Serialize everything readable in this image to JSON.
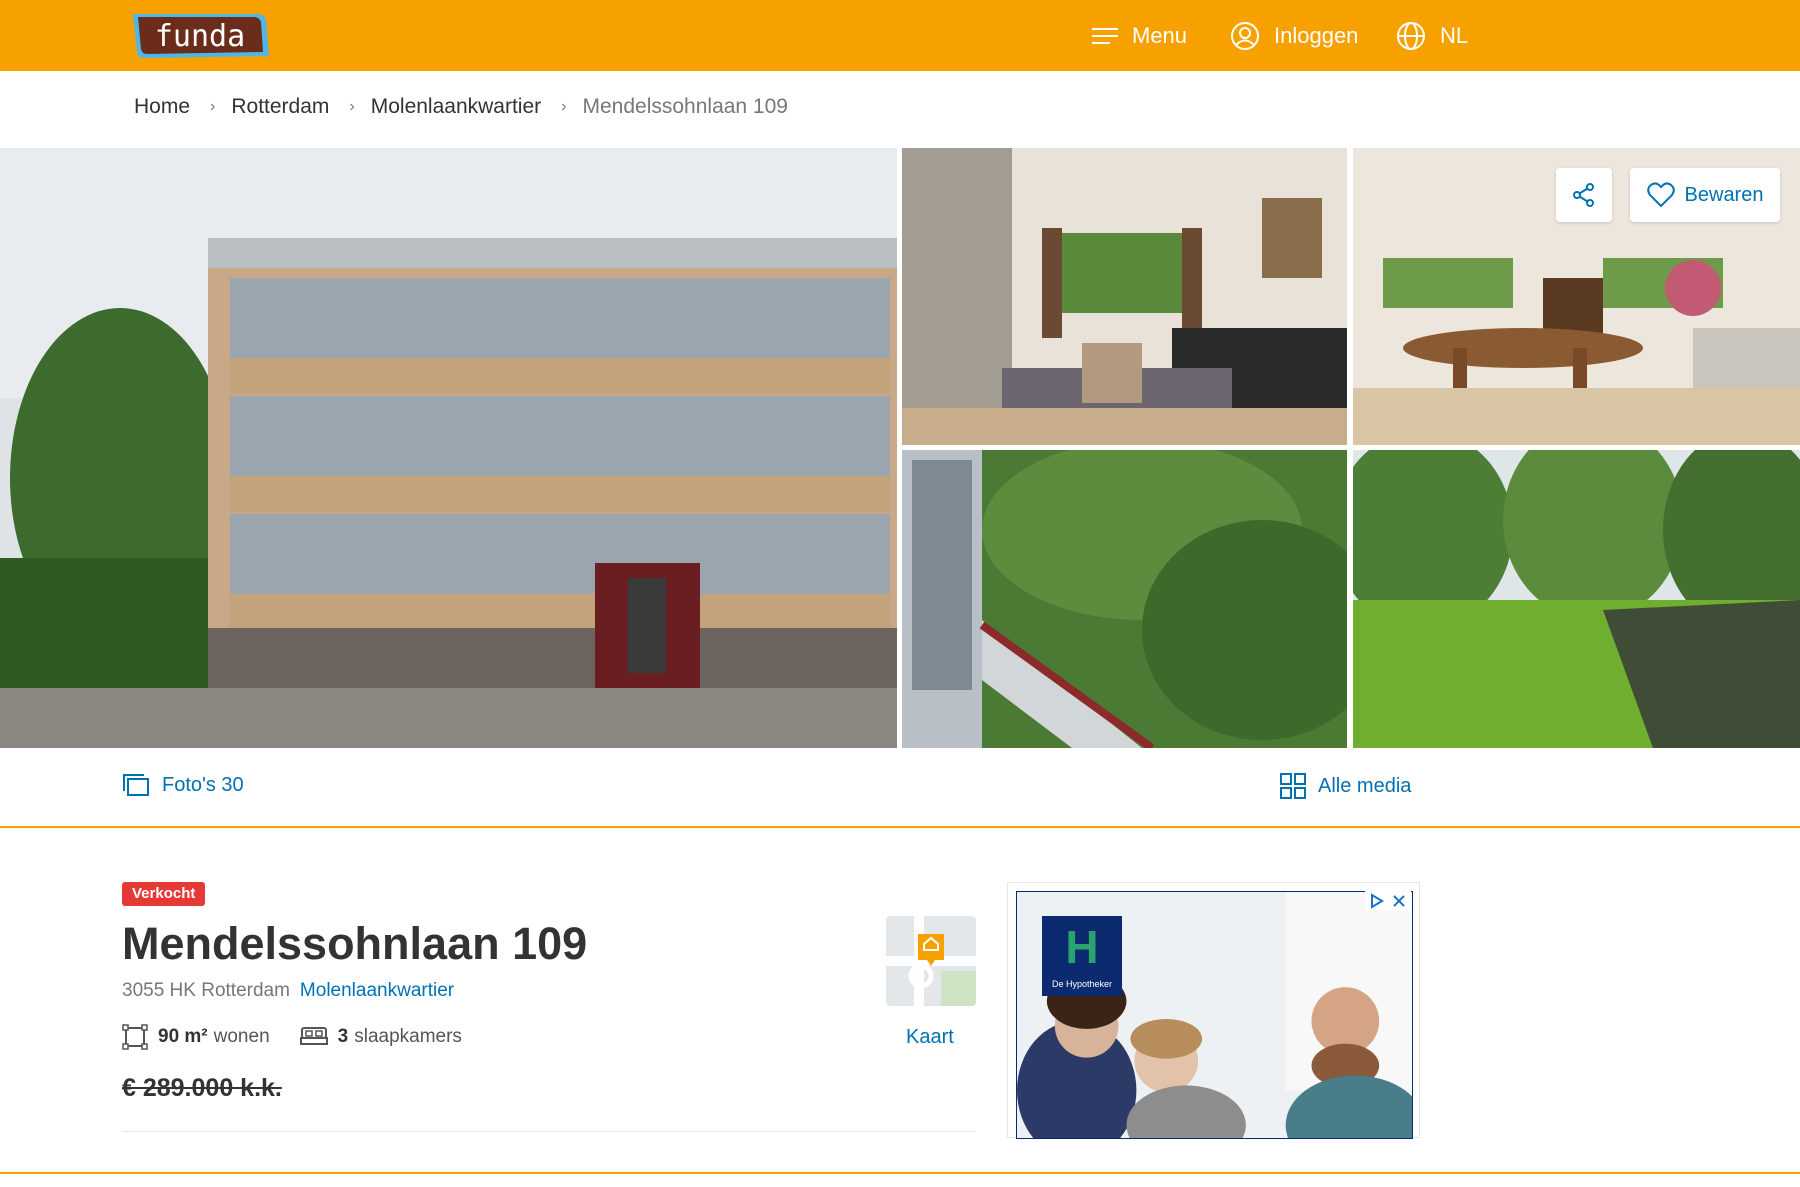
{
  "header": {
    "logo_text": "funda",
    "menu_label": "Menu",
    "login_label": "Inloggen",
    "lang_label": "NL"
  },
  "breadcrumb": [
    "Home",
    "Rotterdam",
    "Molenlaankwartier",
    "Mendelssohnlaan 109"
  ],
  "gallery": {
    "save_label": "Bewaren"
  },
  "media": {
    "photos_label": "Foto's 30",
    "all_media_label": "Alle media"
  },
  "listing": {
    "status": "Verkocht",
    "title": "Mendelssohnlaan 109",
    "postal_city": "3055 HK Rotterdam",
    "neighbourhood": "Molenlaankwartier",
    "area_value": "90 m²",
    "area_unit": "wonen",
    "bedrooms_value": "3",
    "bedrooms_unit": "slaapkamers",
    "price": "€ 289.000 k.k.",
    "map_label": "Kaart"
  },
  "ad": {
    "brand_letter": "H",
    "brand_name": "De Hypotheker"
  },
  "colors": {
    "brand_orange": "#f7a100",
    "link_blue": "#0071b3",
    "sold_red": "#e53935"
  }
}
